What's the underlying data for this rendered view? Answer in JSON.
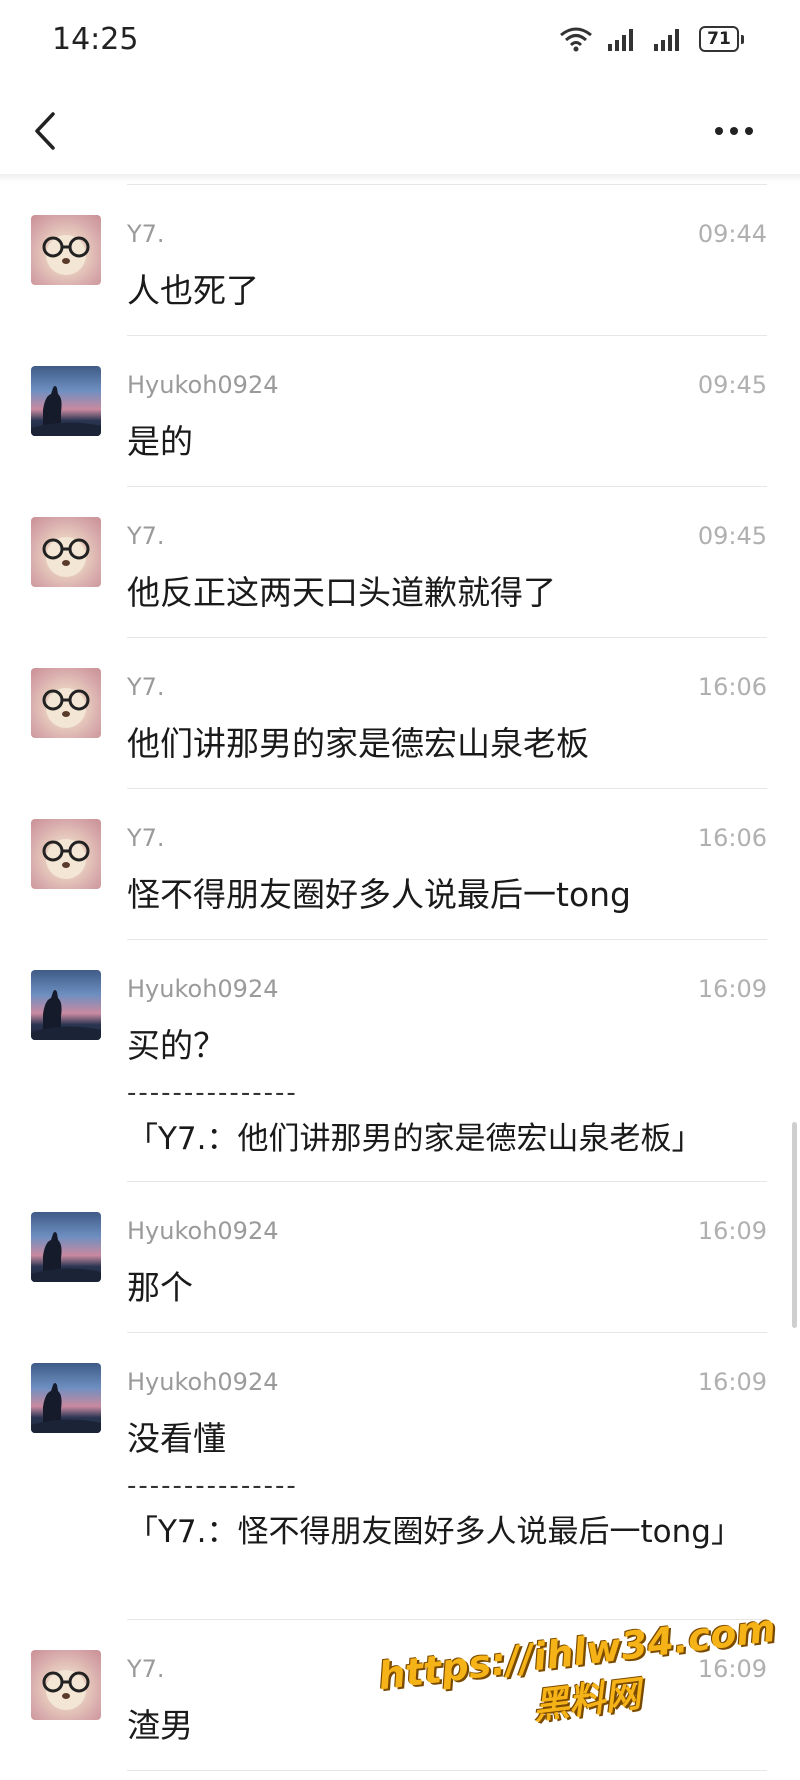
{
  "status_bar": {
    "time": "14:25",
    "battery": "71"
  },
  "nav": {
    "back_icon": "chevron-left-icon",
    "more_icon": "more-horizontal-icon"
  },
  "messages": [
    {
      "sender": "Y7.",
      "time": "09:44",
      "text": "人也死了",
      "avatar": "bear"
    },
    {
      "sender": "Hyukoh0924",
      "time": "09:45",
      "text": "是的",
      "avatar": "sky"
    },
    {
      "sender": "Y7.",
      "time": "09:45",
      "text": "他反正这两天口头道歉就得了",
      "avatar": "bear"
    },
    {
      "sender": "Y7.",
      "time": "16:06",
      "text": "他们讲那男的家是德宏山泉老板",
      "avatar": "bear"
    },
    {
      "sender": "Y7.",
      "time": "16:06",
      "text": "怪不得朋友圈好多人说最后一tong",
      "avatar": "bear"
    },
    {
      "sender": "Hyukoh0924",
      "time": "16:09",
      "text": "买的？",
      "divider": "---------------",
      "quote": "「Y7.：他们讲那男的家是德宏山泉老板」",
      "avatar": "sky"
    },
    {
      "sender": "Hyukoh0924",
      "time": "16:09",
      "text": "那个",
      "avatar": "sky"
    },
    {
      "sender": "Hyukoh0924",
      "time": "16:09",
      "text": "没看懂",
      "divider": "---------------",
      "quote": "「Y7.：怪不得朋友圈好多人说最后一tong」",
      "avatar": "sky"
    },
    {
      "sender": "Y7.",
      "time": "16:09",
      "text": "渣男",
      "avatar": "bear"
    }
  ],
  "watermark": {
    "url": "https://ihlw34.com",
    "name": "黑料网"
  },
  "colors": {
    "background": "#ffffff",
    "meta_text": "#9a9a9a",
    "divider": "#e6e6e6",
    "watermark": "#f6b317"
  }
}
